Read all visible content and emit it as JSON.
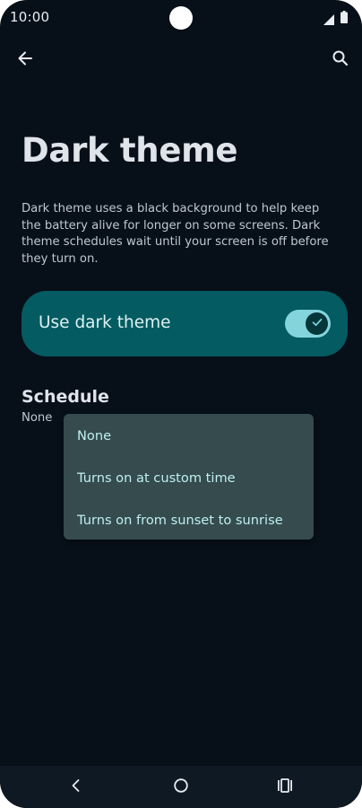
{
  "status_bar": {
    "time": "10:00",
    "icons": [
      "signal-icon",
      "battery-icon"
    ]
  },
  "app_bar": {
    "back_icon": "arrow-back-icon",
    "search_icon": "search-icon"
  },
  "page": {
    "title": "Dark theme",
    "description": "Dark theme uses a black background to help keep the battery alive for longer on some screens. Dark theme schedules wait until your screen is off before they turn on."
  },
  "dark_theme_toggle": {
    "label": "Use dark theme",
    "enabled": true
  },
  "schedule": {
    "title": "Schedule",
    "value": "None",
    "menu": {
      "open": true,
      "options": [
        {
          "label": "None"
        },
        {
          "label": "Turns on at custom time"
        },
        {
          "label": "Turns on from sunset to sunrise"
        }
      ]
    }
  },
  "nav_bar": {
    "icons": [
      "nav-back-icon",
      "nav-home-icon",
      "nav-recents-icon"
    ]
  },
  "colors": {
    "background": "#070f19",
    "card": "#045b61",
    "switch_track": "#84d4dc",
    "menu": "#354b4d",
    "menu_text": "#bfeff2"
  }
}
